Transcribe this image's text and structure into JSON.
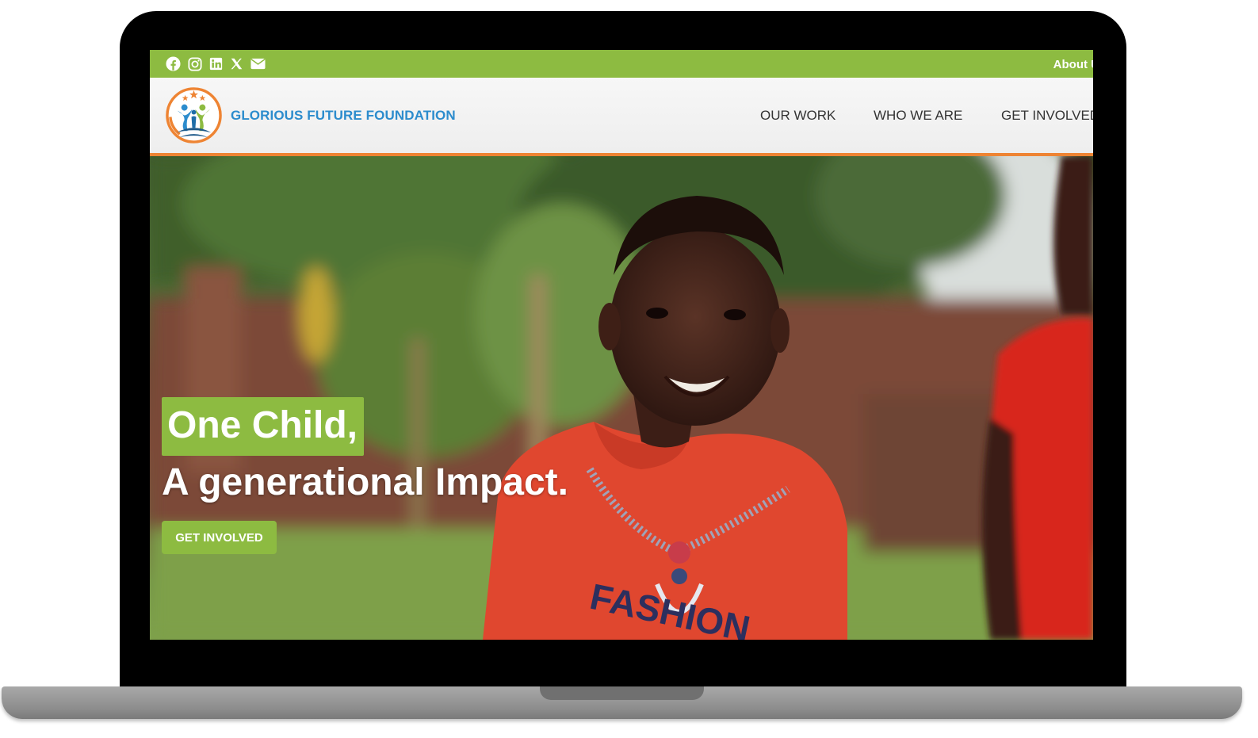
{
  "topbar": {
    "background": "#8dbb41",
    "social_icons": [
      "facebook-icon",
      "instagram-icon",
      "linkedin-icon",
      "x-icon",
      "mail-icon"
    ],
    "link_label": "About U"
  },
  "header": {
    "brand_name": "GLORIOUS FUTURE FOUNDATION",
    "brand_color": "#2c8ccd",
    "accent_border": "#ee8433",
    "nav": [
      {
        "label": "OUR WORK"
      },
      {
        "label": "WHO WE ARE"
      },
      {
        "label": "GET INVOLVED"
      }
    ]
  },
  "hero": {
    "headline_line1": "One Child,",
    "headline_line2": "A generational Impact.",
    "cta_label": "GET INVOLVED",
    "accent": "#8dbb41",
    "shirt_print": "FASHION"
  }
}
